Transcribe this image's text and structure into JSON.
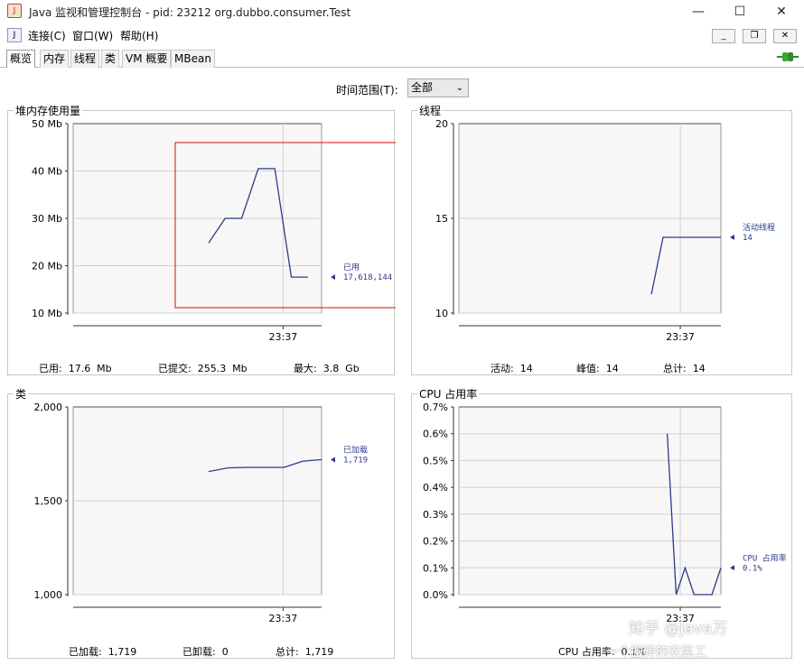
{
  "window": {
    "title": "Java 监视和管理控制台 - pid: 23212 org.dubbo.consumer.Test",
    "icon": "java-coffee-icon"
  },
  "menu": {
    "items": [
      {
        "label": "连接(C)"
      },
      {
        "label": "窗口(W)"
      },
      {
        "label": "帮助(H)"
      }
    ]
  },
  "tabs": [
    {
      "label": "概览",
      "active": true
    },
    {
      "label": "内存",
      "active": false
    },
    {
      "label": "线程",
      "active": false
    },
    {
      "label": "类",
      "active": false
    },
    {
      "label": "VM 概要",
      "active": false
    },
    {
      "label": "MBean",
      "active": false
    }
  ],
  "time_range": {
    "label": "时间范围(T):",
    "selected": "全部"
  },
  "panels": {
    "heap": {
      "title": "堆内存使用量",
      "legend_name": "已用",
      "legend_value": "17,618,144",
      "stats": [
        "已用:  17.6  Mb",
        "已提交:  255.3  Mb",
        "最大:  3.8  Gb"
      ]
    },
    "threads": {
      "title": "线程",
      "legend_name": "活动线程",
      "legend_value": "14",
      "stats": [
        "活动:  14",
        "峰值:  14",
        "总计:  14"
      ]
    },
    "classes": {
      "title": "类",
      "legend_name": "已加载",
      "legend_value": "1,719",
      "stats": [
        "已加载:  1,719",
        "已卸载:  0",
        "总计:  1,719"
      ]
    },
    "cpu": {
      "title": "CPU 占用率",
      "legend_name": "CPU 占用率",
      "legend_value": "0.1%",
      "stats": [
        "CPU 占用率:  0.1%"
      ]
    }
  },
  "watermark": {
    "line1": "知乎 @Java万",
    "line2": "一个搬砖的农民工"
  },
  "colors": {
    "series": "#2b3a8c",
    "selection": "#d8372a",
    "plot_bg": "#f7f7f7",
    "grid": "#d0d0d0"
  },
  "chart_data": [
    {
      "type": "line",
      "title": "堆内存使用量",
      "x_tick": "23:37",
      "y_ticks": [
        "10 Mb",
        "20 Mb",
        "30 Mb",
        "40 Mb",
        "50 Mb"
      ],
      "ylim": [
        10,
        50
      ],
      "x": [
        0,
        1,
        2,
        3,
        4,
        5,
        6
      ],
      "series": [
        {
          "name": "已用",
          "values": [
            24.8,
            30,
            30,
            40.5,
            40.5,
            17.6,
            17.6
          ]
        }
      ]
    },
    {
      "type": "line",
      "title": "线程",
      "x_tick": "23:37",
      "y_ticks": [
        "10",
        "15",
        "20"
      ],
      "ylim": [
        10,
        20
      ],
      "x": [
        0,
        1,
        2,
        3,
        4,
        5,
        6
      ],
      "series": [
        {
          "name": "活动线程",
          "values": [
            11,
            14,
            14,
            14,
            14,
            14,
            14
          ]
        }
      ]
    },
    {
      "type": "line",
      "title": "类",
      "x_tick": "23:37",
      "y_ticks": [
        "1,000",
        "1,500",
        "2,000"
      ],
      "ylim": [
        1000,
        2000
      ],
      "x": [
        0,
        1,
        2,
        3,
        4,
        5,
        6
      ],
      "series": [
        {
          "name": "已加载",
          "values": [
            1656,
            1675,
            1678,
            1678,
            1678,
            1711,
            1719
          ]
        }
      ]
    },
    {
      "type": "line",
      "title": "CPU 占用率",
      "x_tick": "23:37",
      "y_ticks": [
        "0.0%",
        "0.1%",
        "0.2%",
        "0.3%",
        "0.4%",
        "0.5%",
        "0.6%",
        "0.7%"
      ],
      "ylim": [
        0,
        0.7
      ],
      "x": [
        0,
        1,
        2,
        3,
        4,
        5,
        6
      ],
      "series": [
        {
          "name": "CPU 占用率",
          "values": [
            0.6,
            0.0,
            0.1,
            0.0,
            0.0,
            0.0,
            0.1
          ]
        }
      ]
    }
  ]
}
